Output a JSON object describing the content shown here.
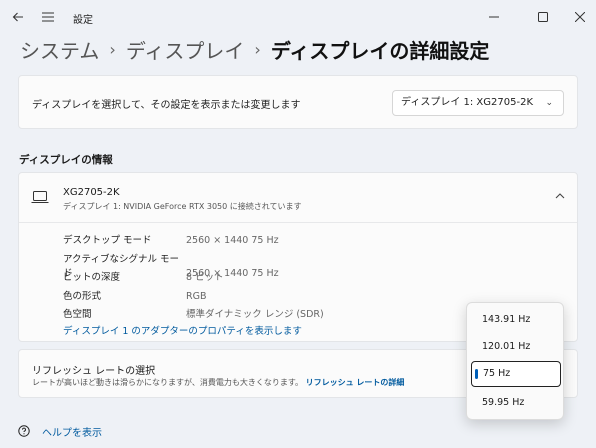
{
  "window": {
    "title": "設定"
  },
  "breadcrumb": [
    "システム",
    "ディスプレイ",
    "ディスプレイの詳細設定"
  ],
  "display_select": {
    "description": "ディスプレイを選択して、その設定を表示または変更します",
    "selected": "ディスプレイ 1: XG2705-2K"
  },
  "info_section": {
    "title": "ディスプレイの情報",
    "monitor_name": "XG2705-2K",
    "monitor_sub": "ディスプレイ 1: NVIDIA GeForce RTX 3050 に接続されています",
    "rows": [
      {
        "key": "デスクトップ モード",
        "value": "2560 × 1440 75 Hz"
      },
      {
        "key": "アクティブなシグナル モード",
        "value": "2560 × 1440 75 Hz"
      },
      {
        "key": "ビットの深度",
        "value": "8 ビット"
      },
      {
        "key": "色の形式",
        "value": "RGB"
      },
      {
        "key": "色空間",
        "value": "標準ダイナミック レンジ (SDR)"
      }
    ],
    "adapter_link": "ディスプレイ 1 のアダプターのプロパティを表示します"
  },
  "refresh": {
    "title": "リフレッシュ レートの選択",
    "desc": "レートが高いほど動きは滑らかになりますが、消費電力も大きくなります。",
    "link": "リフレッシュ レートの詳細"
  },
  "refresh_options": [
    "143.91 Hz",
    "120.01 Hz",
    "75 Hz",
    "59.95 Hz"
  ],
  "refresh_selected": "75 Hz",
  "help": {
    "label": "ヘルプを表示"
  },
  "colors": {
    "accent": "#005fb8",
    "link": "#005a9e",
    "background": "#eef1f6"
  }
}
